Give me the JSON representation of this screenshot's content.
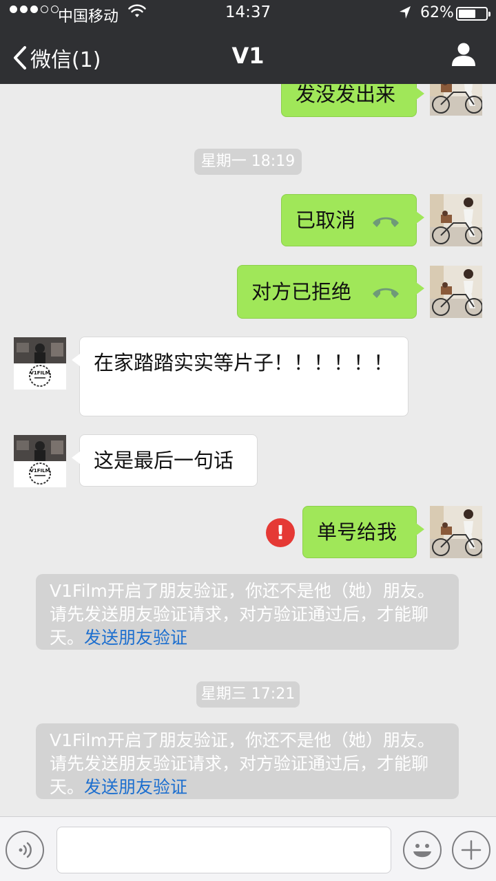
{
  "status_bar": {
    "carrier": "中国移动",
    "time": "14:37",
    "battery_percent": "62%",
    "battery_level": 0.62
  },
  "nav": {
    "back_label": "微信(1)",
    "title": "V1"
  },
  "messages": {
    "m0": {
      "text": "发没发出来",
      "side": "me"
    },
    "ts1": "星期一 18:19",
    "m1": {
      "text": "已取消",
      "side": "me",
      "icon": "phone-icon"
    },
    "m2": {
      "text": "对方已拒绝",
      "side": "me",
      "icon": "phone-icon"
    },
    "m3": {
      "text": "在家踏踏实实等片子！！！！！！",
      "side": "them"
    },
    "m4": {
      "text": "这是最后一句话",
      "side": "them"
    },
    "m5": {
      "text": "单号给我",
      "side": "me",
      "status": "failed",
      "status_icon": "!"
    },
    "n1": {
      "text": "V1Film开启了朋友验证，你还不是他（她）朋友。请先发送朋友验证请求，对方验证通过后，才能聊天。",
      "link": "发送朋友验证"
    },
    "ts2": "星期三 17:21",
    "n2": {
      "text": "V1Film开启了朋友验证，你还不是他（她）朋友。请先发送朋友验证请求，对方验证通过后，才能聊天。",
      "link": "发送朋友验证"
    }
  },
  "avatars": {
    "them_logo_text": "V1FILM"
  },
  "input_bar": {
    "voice_icon": "voice-icon",
    "emoji_icon": "emoji-icon",
    "plus_icon": "plus-icon",
    "placeholder": ""
  },
  "colors": {
    "nav_bg": "#2f3033",
    "my_bubble": "#a0e759",
    "their_bubble": "#ffffff",
    "chat_bg": "#ebebeb",
    "link": "#1d6fcf",
    "error": "#e53935"
  }
}
